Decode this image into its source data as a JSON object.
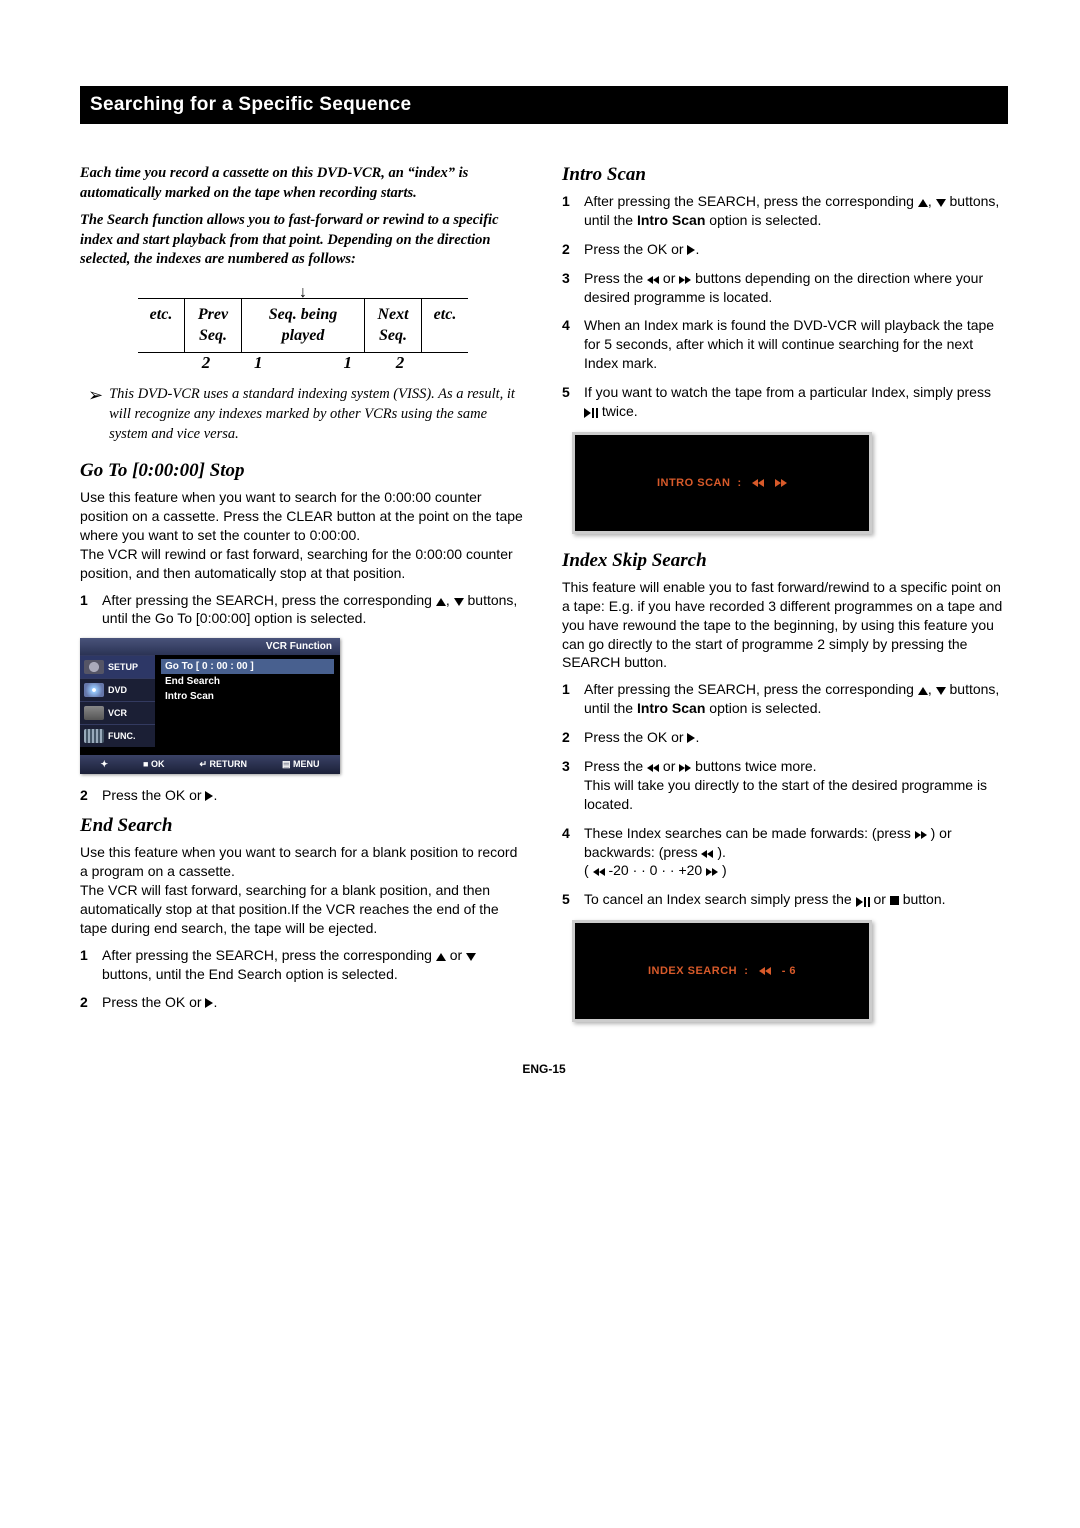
{
  "title": "Searching for a Specific Sequence",
  "footer": "ENG-15",
  "left": {
    "intro1": "Each time you record a cassette on this DVD-VCR, an “index” is automatically marked on the tape when recording starts.",
    "intro2": "The Search function allows you to fast-forward or rewind to a specific index and start playback from that point. Depending on the direction selected, the indexes are numbered as follows:",
    "diagram": {
      "cells": [
        "etc.",
        "Prev\nSeq.",
        "Seq. being\nplayed",
        "Next\nSeq.",
        "etc."
      ],
      "nums": [
        "",
        "2",
        "1",
        "1",
        "2",
        ""
      ]
    },
    "note": "This DVD-VCR uses a standard indexing system (VISS). As a result, it will recognize any indexes marked by other VCRs using the same system and vice versa.",
    "goto": {
      "heading": "Go To [0:00:00] Stop",
      "body": "Use this feature when you want to search for the 0:00:00 counter position on a cassette. Press the CLEAR button at the point on the tape where you want to set the counter to 0:00:00.\nThe VCR will rewind or fast forward, searching for the 0:00:00 counter position, and then automatically stop at that position.",
      "step1a": "After pressing the SEARCH, press the corresponding ",
      "step1b": " buttons, until the Go To [0:00:00] option is selected."
    },
    "osd": {
      "header": "VCR Function",
      "tabs": [
        "SETUP",
        "DVD",
        "VCR",
        "FUNC."
      ],
      "items": [
        "Go To [ 0 : 00 : 00 ]",
        "End Search",
        "Intro Scan"
      ],
      "footer": [
        "■ OK",
        "↵ RETURN",
        "▤ MENU"
      ]
    },
    "pressok": "Press the OK or ",
    "or": " or ",
    "endsearch": {
      "heading": "End Search",
      "body": "Use this feature when you want to search for a blank position to record a program on a cassette.\nThe VCR will fast forward, searching for a blank position, and then automatically stop at that position.If the VCR reaches the end of the tape during end search, the tape will be ejected.",
      "step1a": "After pressing the SEARCH, press the corresponding ",
      "step1b": " buttons, until the End Search option is selected."
    }
  },
  "right": {
    "pressthe": "Press the ",
    "introscan": {
      "heading": "Intro Scan",
      "step1a": "After pressing the SEARCH, press the corresponding ",
      "step1b": " buttons, until the ",
      "step1bold": "Intro Scan",
      "step1c": " option is selected.",
      "step3": " buttons depending on the direction where your desired programme is located.",
      "step4": "When an Index mark is found the DVD-VCR will playback the tape for 5 seconds, after which it will continue searching for the next Index mark.",
      "step5a": "If you want to watch the tape from a particular Index, simply press ",
      "step5b": " twice.",
      "osd": "INTRO SCAN"
    },
    "indexskip": {
      "heading": "Index Skip Search",
      "body": "This feature will enable you to fast forward/rewind to a specific point on a tape:  E.g. if you have recorded 3 different programmes on a tape and you have rewound the tape to the beginning, by using this feature you can go directly to the start of programme 2 simply by pressing the SEARCH button.",
      "step3": " buttons twice more.\nThis will take you directly to the start of the desired programme is located.",
      "step4a": "These Index searches can be made forwards: (press ",
      "step4b": " ) or backwards: (press ",
      "step4c": " ).",
      "scale": " -20 ·  ·  0  ·  · +20 ",
      "step5a": "To cancel an Index search simply press the ",
      "step5b": " button.",
      "osd": "INDEX SEARCH",
      "osdval": "- 6"
    }
  }
}
